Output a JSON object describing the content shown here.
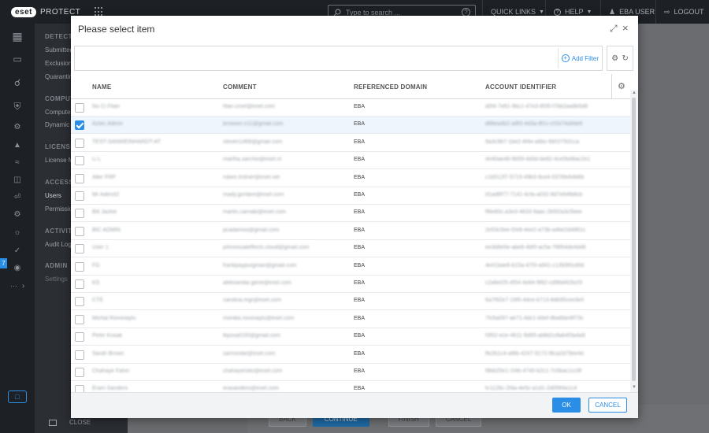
{
  "app": {
    "logo_badge": "eset",
    "logo_text": "PROTECT"
  },
  "topbar": {
    "search_placeholder": "Type to search ...",
    "quick_links": "QUICK LINKS",
    "help": "HELP",
    "user": "EBA USER",
    "logout": "LOGOUT"
  },
  "rail": {
    "badge": "7",
    "more": "···"
  },
  "sidebar": {
    "sections": [
      {
        "label": "DETECTIO",
        "items": [
          "Submitted",
          "Exclusions",
          "Quarantine"
        ]
      },
      {
        "label": "COMPUTE",
        "items": [
          "Computer",
          "Dynamic G"
        ]
      },
      {
        "label": "LICENSE",
        "items": [
          "License M"
        ]
      },
      {
        "label": "ACCESS R",
        "items": [
          "Users",
          "Permission"
        ]
      },
      {
        "label": "ACTIVITY",
        "items": [
          "Audit Log"
        ]
      },
      {
        "label": "ADMIN",
        "items": [
          "Settings"
        ]
      }
    ],
    "close": "CLOSE"
  },
  "background_footer": {
    "back": "BACK",
    "continue": "CONTINUE",
    "finish": "FINISH",
    "cancel": "CANCEL"
  },
  "modal": {
    "title": "Please select item",
    "add_filter": "Add Filter",
    "columns": [
      "NAME",
      "COMMENT",
      "REFERENCED DOMAIN",
      "ACCOUNT IDENTIFIER"
    ],
    "rows": [
      {
        "name": "No Ci Fitan",
        "comment": "fitan.cmet@eset.com",
        "domain": "EBA",
        "account": "a5f4-7e61-9bc1-47e3-8f35-f7bb2aa9b5d8",
        "checked": false
      },
      {
        "name": "Aztec Admin",
        "comment": "browser.o11@gmail.com",
        "domain": "EBA",
        "account": "d86ea4b2-a9f3-4d3a-8f1c-cf1b74a9de6",
        "checked": true
      },
      {
        "name": "TEST-SANWEINHARDT-AT",
        "comment": "steven1468@gmail.com",
        "domain": "EBA",
        "account": "9a3c9b7-1be2-4f4e-a6bc-6bf1f7931ca",
        "checked": false
      },
      {
        "name": "Li L",
        "comment": "martha.sarchio@eset.nl",
        "domain": "EBA",
        "account": "4e40ae48-9b59-4d3d-be82-4ce0b48ac2e1",
        "checked": false
      },
      {
        "name": "Aller FRP",
        "comment": "ruben.trotner@eset.net",
        "domain": "EBA",
        "account": "c1b512f7-5715-49b3-9ce4-0376fe64b6b",
        "checked": false
      },
      {
        "name": "Mr Aderot2",
        "comment": "mady.gorilare@eset.com",
        "domain": "EBA",
        "account": "d1ad8f77-7141-4cfa-a032-8d7e64fb8cb",
        "checked": false
      },
      {
        "name": "Bill Jackie",
        "comment": "martin.carnabi@eset.com",
        "domain": "EBA",
        "account": "ff6e80c-a3e3-4633-9aac-2b5f2a3c5bee",
        "checked": false
      },
      {
        "name": "BIC ADMIN",
        "comment": "pcadamos@gmail.com",
        "domain": "EBA",
        "account": "2e53c5ee-f2e8-4ee2-a73b-a4be2d4961c",
        "checked": false
      },
      {
        "name": "User 1",
        "comment": "johnvisualeffects.cloud@gmail.com",
        "domain": "EBA",
        "account": "ee3d8e5e-abe8-4bf0-ac5a-7f8f64de4d46",
        "checked": false
      },
      {
        "name": "FG",
        "comment": "frankpaypurgman@gmail.com",
        "domain": "EBA",
        "account": "4e41bae6-b15a-47f3-a941-c1393f0cd0d",
        "checked": false
      },
      {
        "name": "KS",
        "comment": "aleksandar.gene@eset.com",
        "domain": "EBA",
        "account": "c2a6ef25-4f54-4e84-9f82-cd96d4f2bcf3",
        "checked": false
      },
      {
        "name": "CTE",
        "comment": "carolina.mgr@eset.com",
        "domain": "EBA",
        "account": "6a7f92e7-19f5-4dce-b713-8db95cee3e0",
        "checked": false
      },
      {
        "name": "Michal Rovonaylu",
        "comment": "monika.rovonaylu@eset.com",
        "domain": "EBA",
        "account": "7fc6a097-ae71-4dc1-b6ef-8ba6be4ff73c",
        "checked": false
      },
      {
        "name": "Peter Kosak",
        "comment": "lkposat100@gmail.com",
        "domain": "EBA",
        "account": "f3f52-ece-4611-9d95-ab8d1c8ab4f3a4a9",
        "checked": false
      },
      {
        "name": "Sarah Brown",
        "comment": "sarmirobe@eset.com",
        "domain": "EBA",
        "account": "ffe2b1c4-af6b-4247-9172-f8ca2d79ee4e",
        "checked": false
      },
      {
        "name": "Chahaye Fahin",
        "comment": "chahayerolio@eset.com",
        "domain": "EBA",
        "account": "f8bb25e1-1f4b-4740-b2c1-7c0bac1cc8f",
        "checked": false
      },
      {
        "name": "Eram Sandero",
        "comment": "erasandero@eset.com",
        "domain": "EBA",
        "account": "fc1126c-2f4a-4e5c-a1d1-2d0f9f4a1c4",
        "checked": false
      }
    ],
    "ok": "OK",
    "cancel": "CANCEL"
  },
  "colors": {
    "accent": "#2b8ee6",
    "sidebar_bg": "#2b2e33",
    "rail_bg": "#1d2025"
  }
}
